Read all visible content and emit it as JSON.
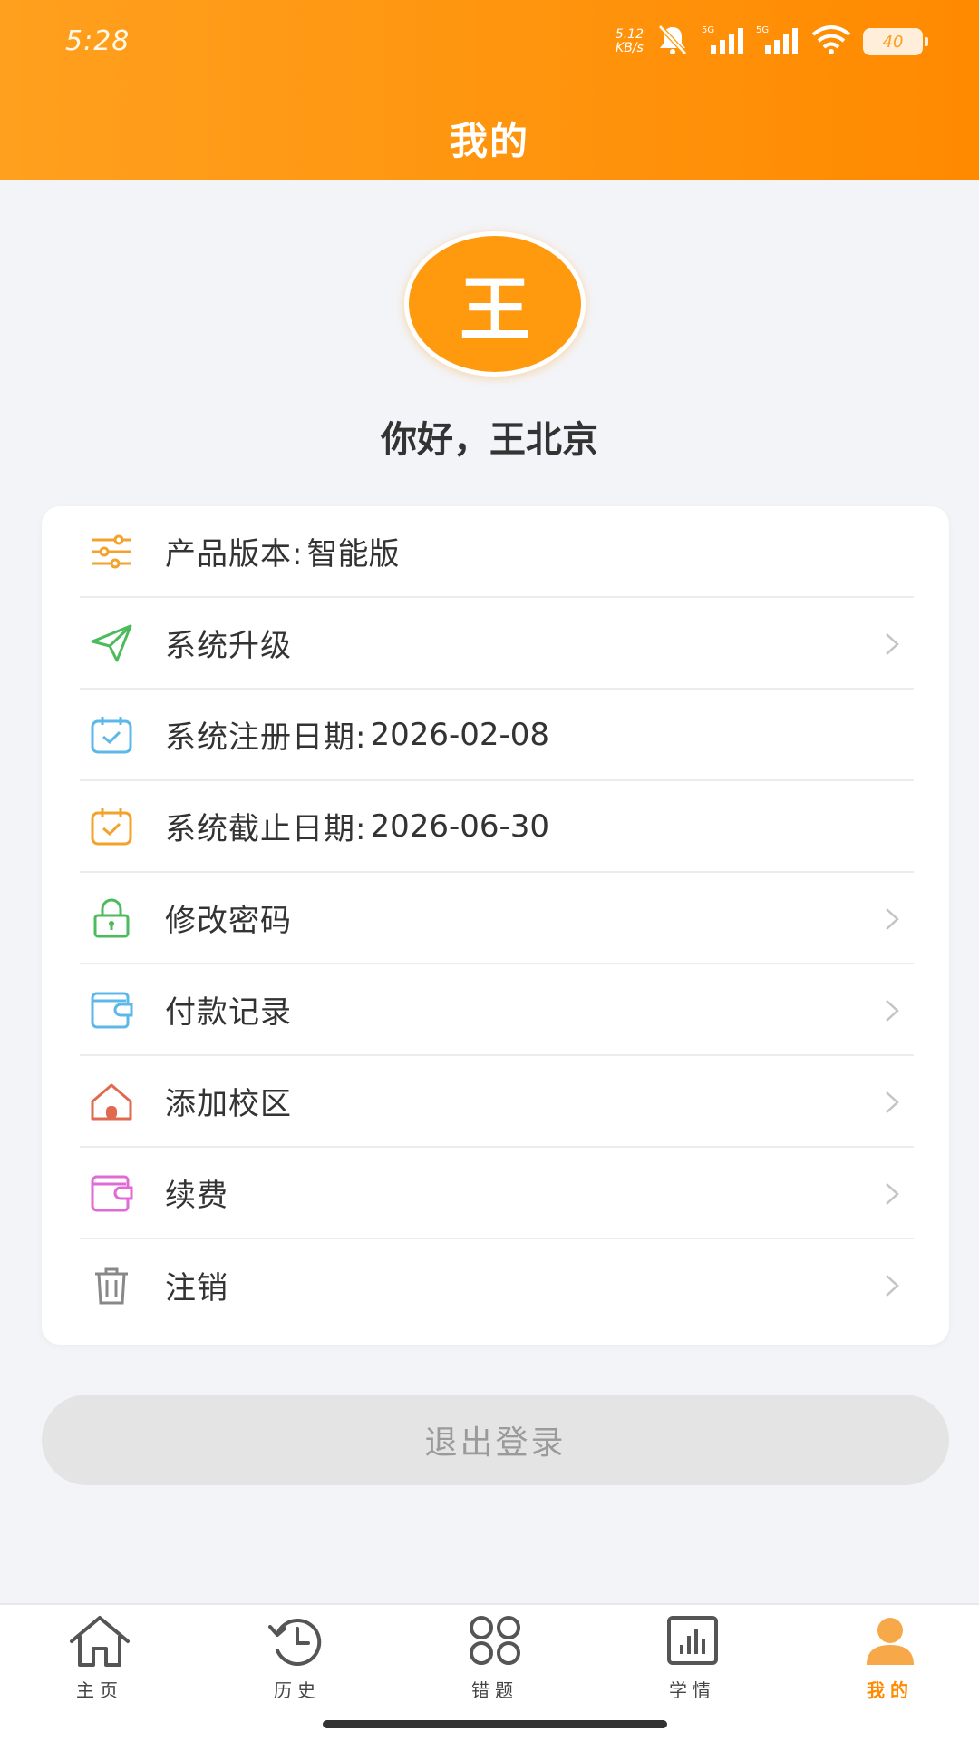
{
  "status_bar": {
    "time": "5:28",
    "net_speed_value": "5.12",
    "net_speed_unit": "KB/s",
    "battery": "40"
  },
  "header": {
    "title": "我的"
  },
  "profile": {
    "avatar_letter": "王",
    "greeting": "你好，王北京"
  },
  "menu": {
    "product_version": {
      "label": "产品版本:",
      "value": "智能版",
      "icon": "sliders-icon",
      "color": "#f3a32b"
    },
    "upgrade": {
      "label": "系统升级",
      "icon": "send-icon",
      "color": "#4cbb5c"
    },
    "register_date": {
      "label": "系统注册日期:",
      "value": "2026-02-08",
      "icon": "calendar-check-icon",
      "color": "#5bb8e8"
    },
    "expire_date": {
      "label": "系统截止日期:",
      "value": "2026-06-30",
      "icon": "calendar-check-icon",
      "color": "#f3a32b"
    },
    "change_password": {
      "label": "修改密码",
      "icon": "lock-icon",
      "color": "#4cbb5c"
    },
    "payment_records": {
      "label": "付款记录",
      "icon": "wallet-icon",
      "color": "#5bb8e8"
    },
    "add_campus": {
      "label": "添加校区",
      "icon": "house-icon",
      "color": "#e06a4f"
    },
    "renew": {
      "label": "续费",
      "icon": "wallet-icon",
      "color": "#e06ad6"
    },
    "cancel_account": {
      "label": "注销",
      "icon": "trash-icon",
      "color": "#888888"
    }
  },
  "logout_label": "退出登录",
  "tabbar": {
    "home": "主页",
    "history": "历史",
    "wrong_questions": "错题",
    "study_status": "学情",
    "mine": "我的"
  },
  "colors": {
    "accent": "#ff9a0f",
    "active_tab": "#ff8a00"
  }
}
